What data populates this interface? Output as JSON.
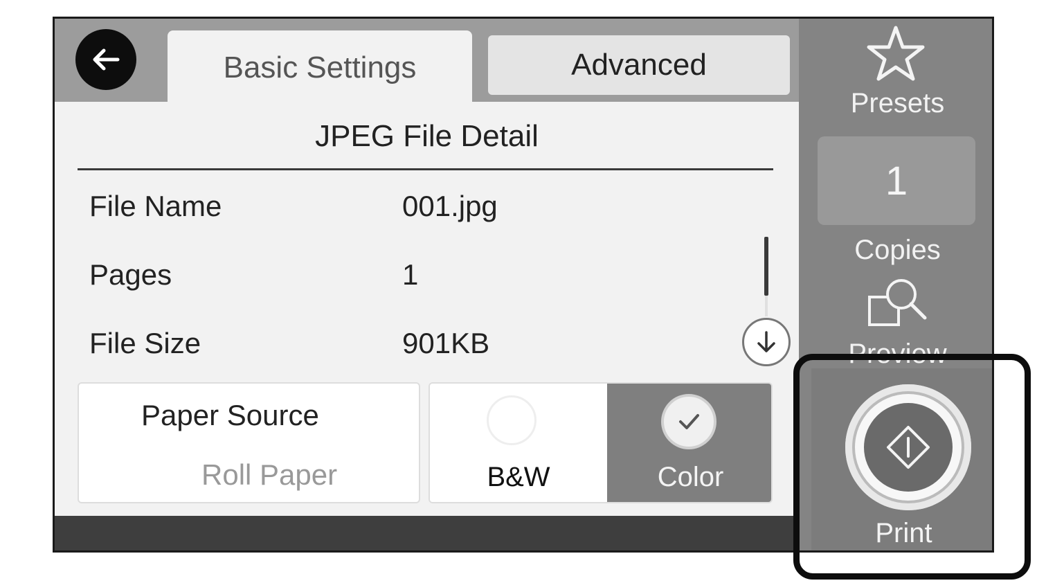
{
  "tabs": {
    "basic_label": "Basic Settings",
    "advanced_label": "Advanced",
    "active": "Basic Settings"
  },
  "detail": {
    "title": "JPEG File Detail",
    "rows": [
      {
        "label": "File Name",
        "value": "001.jpg"
      },
      {
        "label": "Pages",
        "value": "1"
      },
      {
        "label": "File Size",
        "value": "901KB"
      }
    ]
  },
  "paper_source": {
    "label": "Paper Source",
    "value": "Roll Paper"
  },
  "color_mode": {
    "options": [
      "B&W",
      "Color"
    ],
    "selected": "Color"
  },
  "right_panel": {
    "presets_label": "Presets",
    "copies_value": "1",
    "copies_label": "Copies",
    "preview_label": "Preview",
    "print_label": "Print"
  },
  "icons": {
    "back": "back-arrow-icon",
    "presets": "star-icon",
    "scroll_down": "arrow-down-icon",
    "preview": "magnifier-icon",
    "print": "diamond-start-icon",
    "check": "checkmark-icon"
  },
  "colors": {
    "panel_dark": "#848484",
    "selected_option": "#7f7f7f",
    "content_bg": "#f2f2f2",
    "highlight_border": "#0d0d0d"
  }
}
